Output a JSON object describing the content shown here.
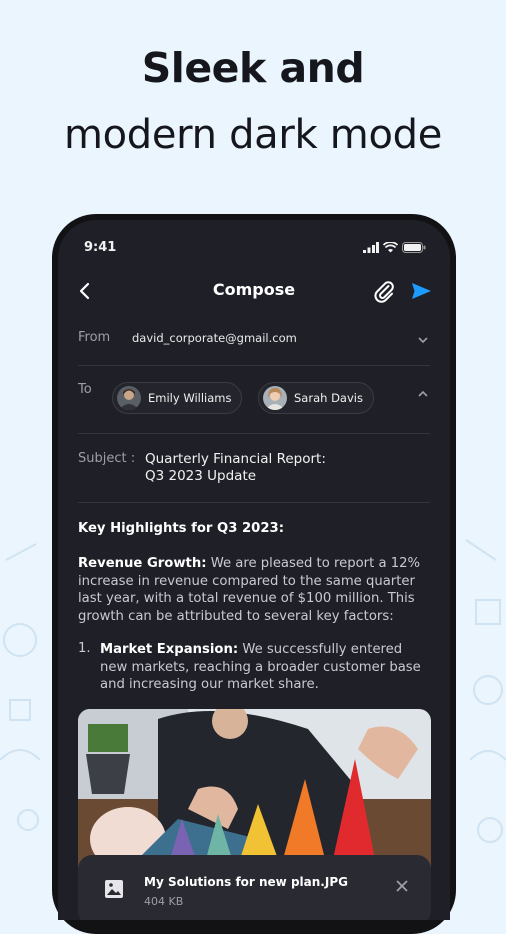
{
  "headline": {
    "line1": "Sleek and",
    "line2": "modern dark mode"
  },
  "status_bar": {
    "time": "9:41"
  },
  "app_bar": {
    "title": "Compose"
  },
  "from": {
    "label": "From",
    "value": "david_corporate@gmail.com"
  },
  "to": {
    "label": "To",
    "recipients": [
      {
        "name": "Emily Williams"
      },
      {
        "name": "Sarah Davis"
      }
    ]
  },
  "subject": {
    "label": "Subject :",
    "line1": "Quarterly Financial Report:",
    "line2": "Q3 2023 Update"
  },
  "body": {
    "heading": "Key Highlights for Q3 2023:",
    "revenue_title": "Revenue Growth:",
    "revenue_text": " We are pleased to report a 12% increase in revenue compared to the same quarter last year, with a total revenue of $100 million. This growth can be attributed to several key factors:",
    "item1_number": "1.",
    "item1_title": "Market Expansion:",
    "item1_text": " We successfully entered new markets, reaching a broader customer base and increasing our market share."
  },
  "attachment": {
    "name": "My Solutions for new plan.JPG",
    "size": "404 KB"
  },
  "colors": {
    "accent": "#1e9bff",
    "background": "#eaf5fd",
    "surface": "#1f2027"
  },
  "icons": [
    "back-icon",
    "paperclip-icon",
    "send-icon",
    "chevron-down-icon",
    "chevron-up-icon",
    "image-file-icon",
    "close-icon",
    "signal-icon",
    "wifi-icon",
    "battery-icon"
  ]
}
